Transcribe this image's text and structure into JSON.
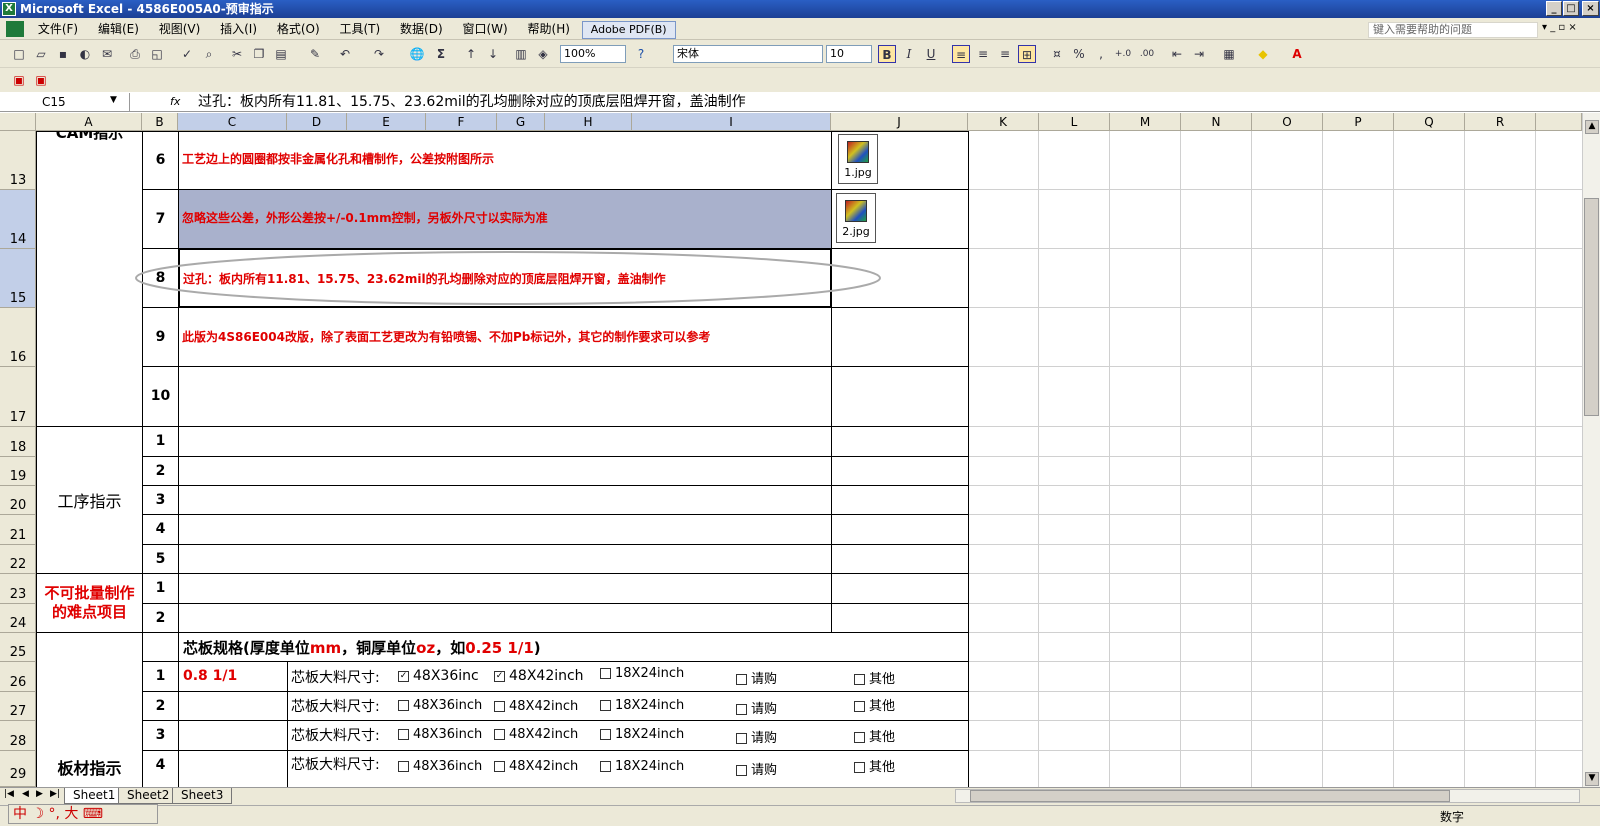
{
  "window": {
    "title": "Microsoft Excel - 4586E005A0-预审指示",
    "app_icon": "excel-icon"
  },
  "menu": [
    "文件(F)",
    "编辑(E)",
    "视图(V)",
    "插入(I)",
    "格式(O)",
    "工具(T)",
    "数据(D)",
    "窗口(W)",
    "帮助(H)",
    "Adobe PDF(B)"
  ],
  "help_placeholder": "键入需要帮助的问题",
  "toolbar": {
    "zoom": "100%",
    "font": "宋体",
    "size": "10",
    "bold": "B",
    "italic": "I",
    "underline": "U",
    "percent": "%",
    "comma": ","
  },
  "formula_bar": {
    "name_box": "C15",
    "fx": "fx",
    "value": "过孔：板内所有11.81、15.75、23.62mil的孔均删除对应的顶底层阻焊开窗，盖油制作"
  },
  "columns": [
    "A",
    "B",
    "C",
    "D",
    "E",
    "F",
    "G",
    "H",
    "I",
    "J",
    "K",
    "L",
    "M",
    "N",
    "O",
    "P",
    "Q",
    "R"
  ],
  "rows": [
    "13",
    "14",
    "15",
    "16",
    "17",
    "18",
    "19",
    "20",
    "21",
    "22",
    "23",
    "24",
    "25",
    "26",
    "27",
    "28",
    "29"
  ],
  "sections": {
    "top_partial": "CAM指示",
    "process": "工序指示",
    "difficult": "不可批量制作的难点项目",
    "board": "板材指示"
  },
  "cam_items": [
    {
      "no": "6",
      "text": "工艺边上的圆圈都按非金属化孔和槽制作，公差按附图所示",
      "attachment": "1.jpg"
    },
    {
      "no": "7",
      "text": "忽略这些公差，外形公差按+/-0.1mm控制，另板外尺寸以实际为准",
      "attachment": "2.jpg"
    },
    {
      "no": "8",
      "text": "过孔：板内所有11.81、15.75、23.62mil的孔均删除对应的顶底层阻焊开窗，盖油制作"
    },
    {
      "no": "9",
      "text": "此版为4S86E004改版，除了表面工艺更改为有铅喷锡、不加Pb标记外，其它的制作要求可以参考"
    },
    {
      "no": "10",
      "text": ""
    }
  ],
  "process_items": [
    "1",
    "2",
    "3",
    "4",
    "5"
  ],
  "difficult_items": [
    "1",
    "2"
  ],
  "board": {
    "header_black1": "芯板规格(厚度单位",
    "header_red1": "mm",
    "header_black2": "，铜厚单位",
    "header_red2": "oz",
    "header_black3": "，如",
    "header_red3": "0.25 1/1",
    "header_black4": ")",
    "rows": [
      {
        "no": "1",
        "spec": "0.8 1/1",
        "label": "芯板大料尺寸:",
        "opt1": "48X36inc",
        "opt1_checked": true,
        "opt2": "48X42inch",
        "opt2_checked": true,
        "opt3": "18X24inch",
        "opt4": "请购",
        "opt5": "其他"
      },
      {
        "no": "2",
        "spec": "",
        "label": "芯板大料尺寸:",
        "opt1": "48X36inch",
        "opt1_checked": false,
        "opt2": "48X42inch",
        "opt2_checked": false,
        "opt3": "18X24inch",
        "opt4": "请购",
        "opt5": "其他"
      },
      {
        "no": "3",
        "spec": "",
        "label": "芯板大料尺寸:",
        "opt1": "48X36inch",
        "opt1_checked": false,
        "opt2": "48X42inch",
        "opt2_checked": false,
        "opt3": "18X24inch",
        "opt4": "请购",
        "opt5": "其他"
      },
      {
        "no": "4",
        "spec": "",
        "label": "芯板大料尺寸:",
        "opt1": "48X36inch",
        "opt1_checked": false,
        "opt2": "48X42inch",
        "opt2_checked": false,
        "opt3": "18X24inch",
        "opt4": "请购",
        "opt5": "其他"
      }
    ]
  },
  "sheet_tabs": [
    "Sheet1",
    "Sheet2",
    "Sheet3"
  ],
  "status": {
    "mode": "数字"
  },
  "ime": {
    "text": "中"
  }
}
